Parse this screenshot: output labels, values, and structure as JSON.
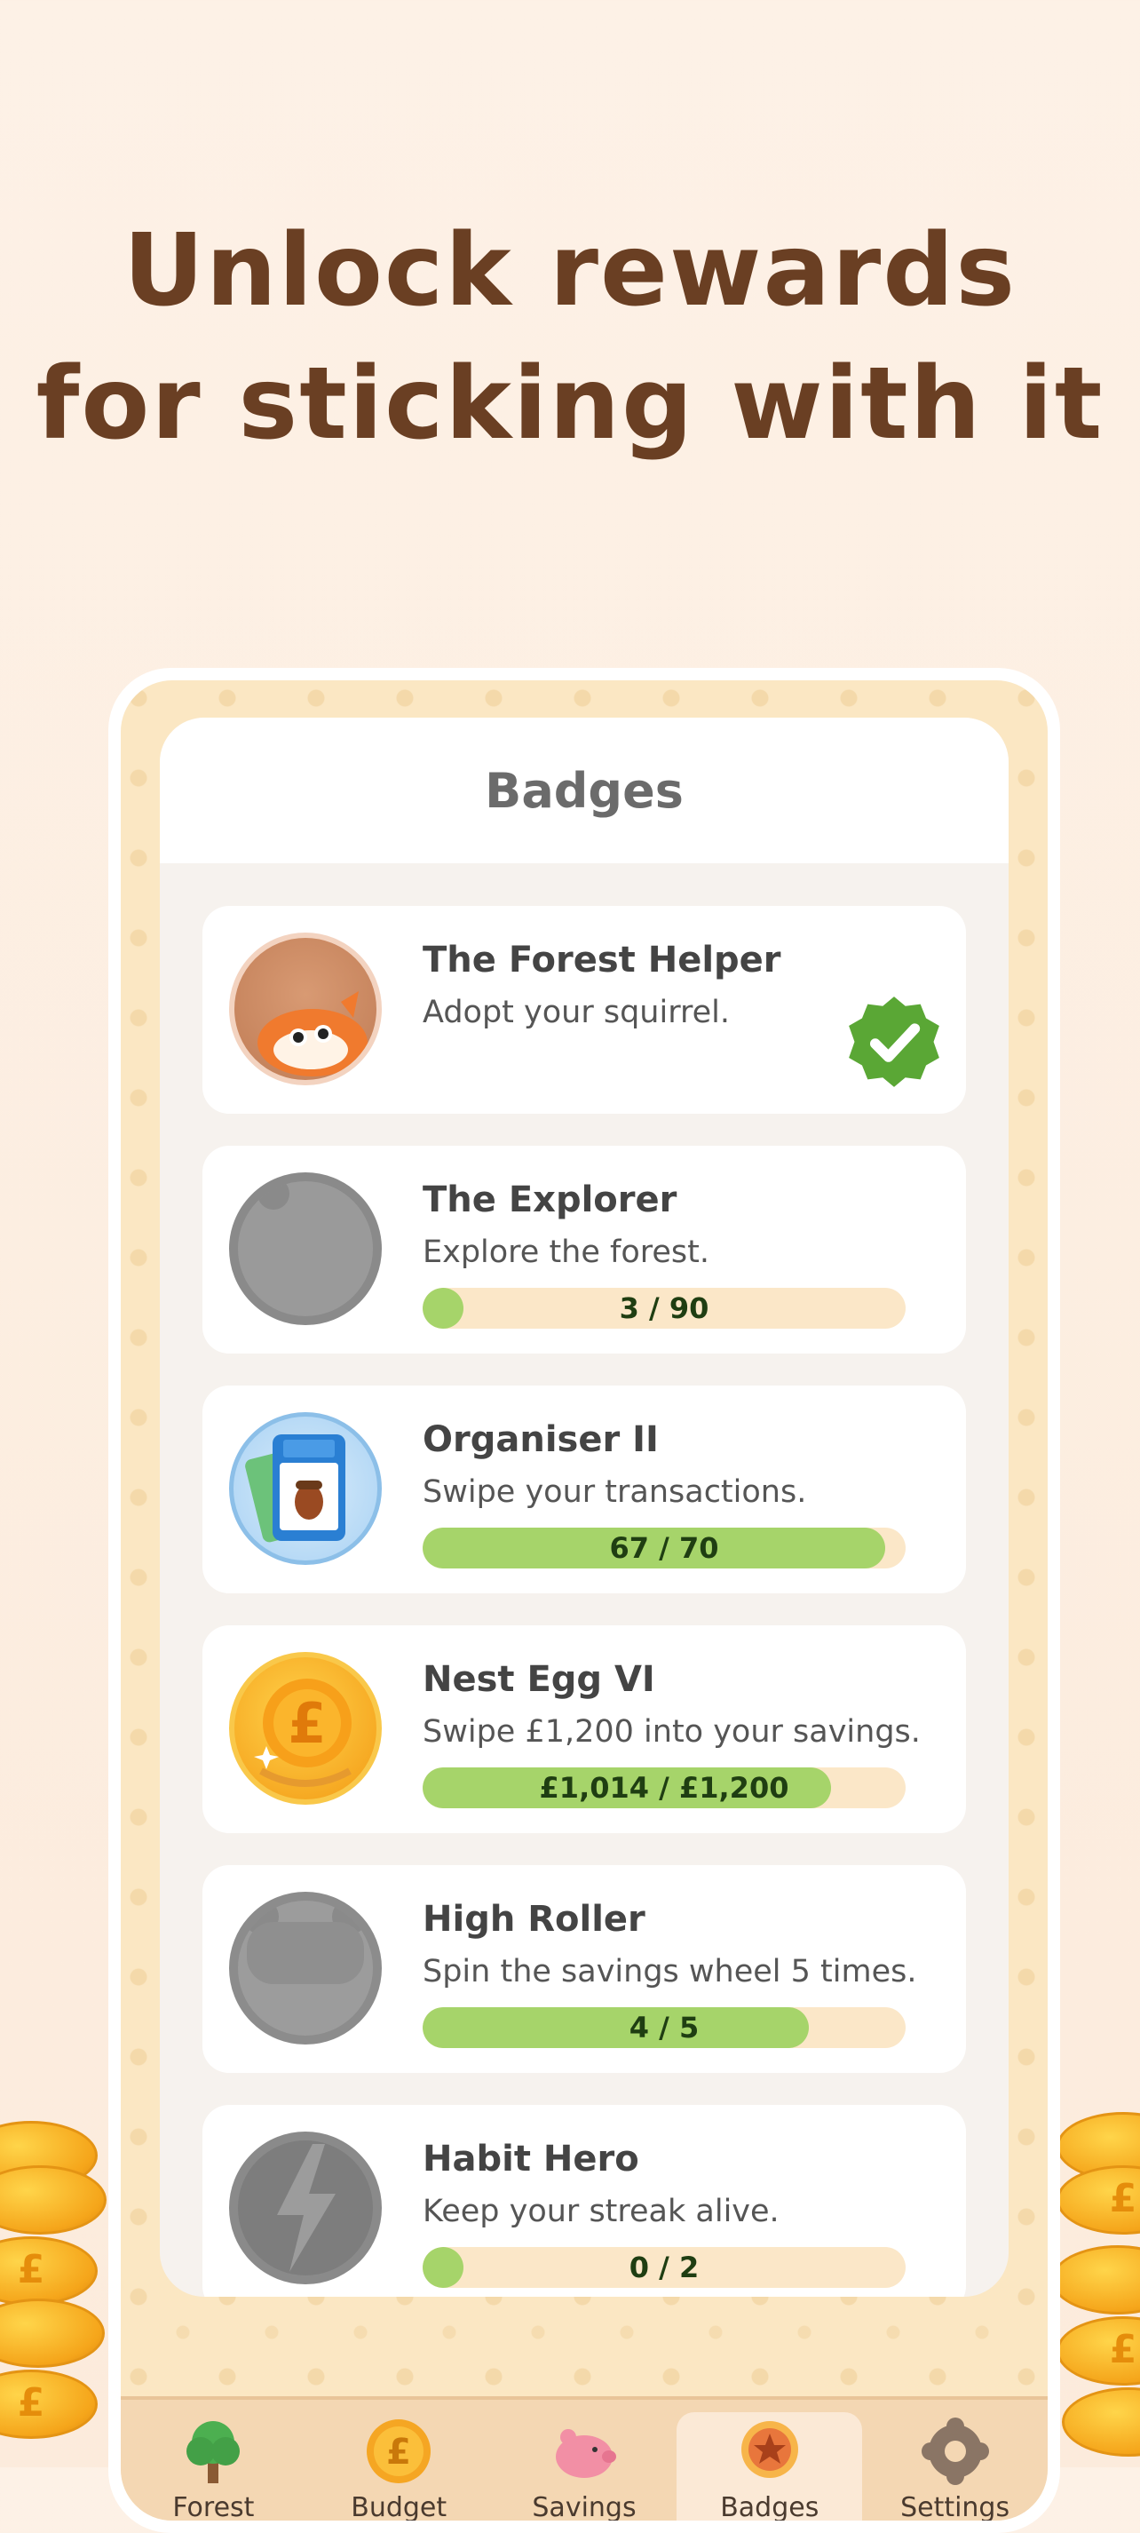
{
  "headline": {
    "line1": "Unlock rewards",
    "line2": "for sticking with it"
  },
  "screen": {
    "title": "Badges",
    "badges": [
      {
        "name": "The Forest Helper",
        "description": "Adopt your squirrel.",
        "completed": true,
        "icon": "squirrel-badge-icon"
      },
      {
        "name": "The Explorer",
        "description": "Explore the forest.",
        "progress_text": "3 / 90",
        "progress": 0.033,
        "icon": "locked-explorer-icon"
      },
      {
        "name": "Organiser II",
        "description": "Swipe your transactions.",
        "progress_text": "67 / 70",
        "progress": 0.957,
        "icon": "receipt-card-icon"
      },
      {
        "name": "Nest Egg VI",
        "description": "Swipe £1,200 into your savings.",
        "progress_text": "£1,014 / £1,200",
        "progress": 0.845,
        "icon": "pound-coin-icon"
      },
      {
        "name": "High Roller",
        "description": "Spin the savings wheel 5 times.",
        "progress_text": "4 / 5",
        "progress": 0.8,
        "icon": "locked-high-roller-icon"
      },
      {
        "name": "Habit Hero",
        "description": "Keep your streak alive.",
        "progress_text": "0 / 2",
        "progress": 0.0,
        "icon": "lightning-icon"
      }
    ],
    "tabs": [
      {
        "label": "Forest",
        "icon": "tree-icon",
        "color": "#4caf50"
      },
      {
        "label": "Budget",
        "icon": "pound-coin-icon",
        "color": "#f5a623"
      },
      {
        "label": "Savings",
        "icon": "piggy-bank-icon",
        "color": "#f28fa5"
      },
      {
        "label": "Badges",
        "icon": "star-badge-icon",
        "color": "#e8763c",
        "active": true
      },
      {
        "label": "Settings",
        "icon": "gear-icon",
        "color": "#8a7565"
      }
    ]
  },
  "colors": {
    "headline": "#6a3f23",
    "progress_fill": "#a6d46a",
    "progress_track": "#fbe7c8",
    "check": "#5aa735"
  }
}
